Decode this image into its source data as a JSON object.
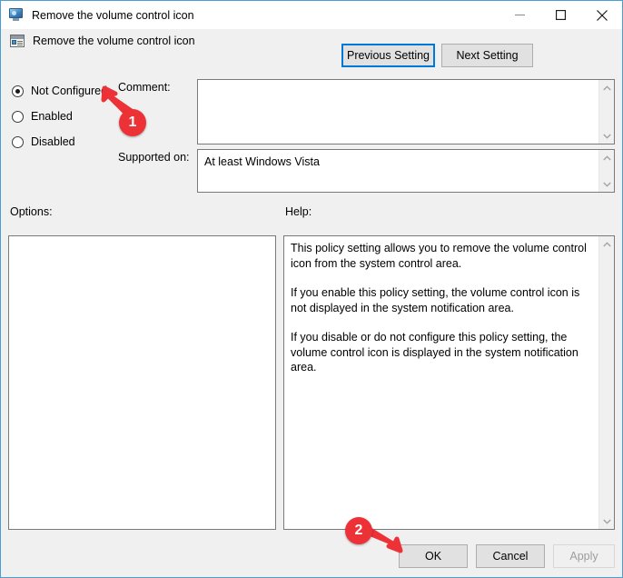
{
  "window": {
    "title": "Remove the volume control icon",
    "title_icon": "monitor-icon",
    "controls": {
      "minimize": "minimize-icon",
      "maximize": "maximize-icon",
      "close": "close-icon"
    },
    "accent_border_color": "#4a9ed4",
    "background_color": "#f0f0f0"
  },
  "header": {
    "icon": "group-policy-setting-icon",
    "title": "Remove the volume control icon"
  },
  "nav": {
    "previous_label": "Previous Setting",
    "next_label": "Next Setting",
    "focus_color": "#0078d7"
  },
  "state_options": [
    {
      "label": "Not Configured",
      "selected": true
    },
    {
      "label": "Enabled",
      "selected": false
    },
    {
      "label": "Disabled",
      "selected": false
    }
  ],
  "fields": {
    "comment_label": "Comment:",
    "comment_value": "",
    "supported_label": "Supported on:",
    "supported_value": "At least Windows Vista"
  },
  "panels": {
    "options_label": "Options:",
    "options_value": "",
    "help_label": "Help:",
    "help_paragraphs": [
      "This policy setting allows you to remove the volume control icon from the system control area.",
      "If you enable this policy setting, the volume control icon is not displayed in the system notification area.",
      "If you disable or do not configure this policy setting, the volume control icon is displayed in the system notification area."
    ]
  },
  "footer": {
    "ok_label": "OK",
    "cancel_label": "Cancel",
    "apply_label": "Apply",
    "apply_enabled": false
  },
  "annotations": {
    "color": "#ed3237",
    "markers": [
      {
        "number": "1",
        "points_to": "Not Configured radio button"
      },
      {
        "number": "2",
        "points_to": "OK button"
      }
    ]
  }
}
